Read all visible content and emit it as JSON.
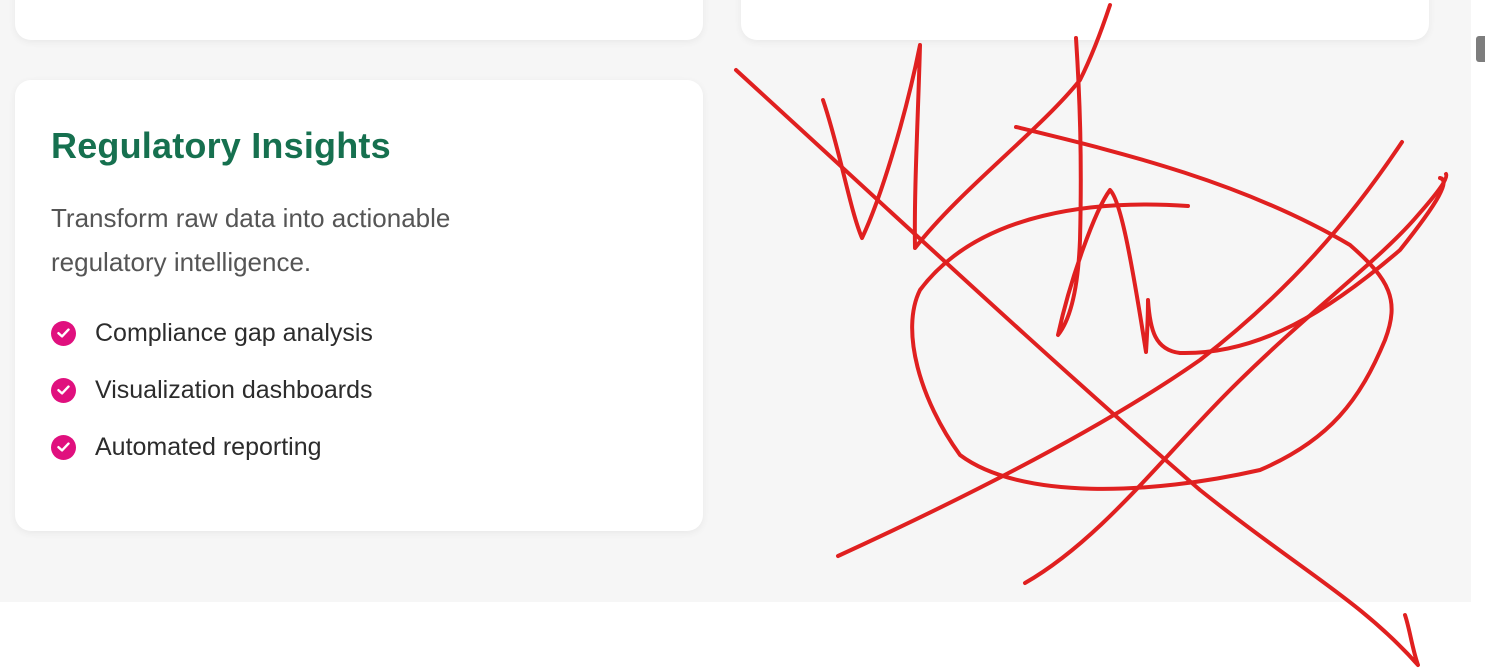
{
  "card": {
    "title": "Regulatory Insights",
    "description": "Transform raw data into actionable regulatory intelligence.",
    "features": [
      "Compliance gap analysis",
      "Visualization dashboards",
      "Automated reporting"
    ]
  },
  "icons": {
    "feature_check": "check-circle-icon"
  },
  "colors": {
    "title": "#16704f",
    "check_badge": "#e0107e",
    "section_background": "#f6f6f6",
    "scribble": "#e02020"
  }
}
